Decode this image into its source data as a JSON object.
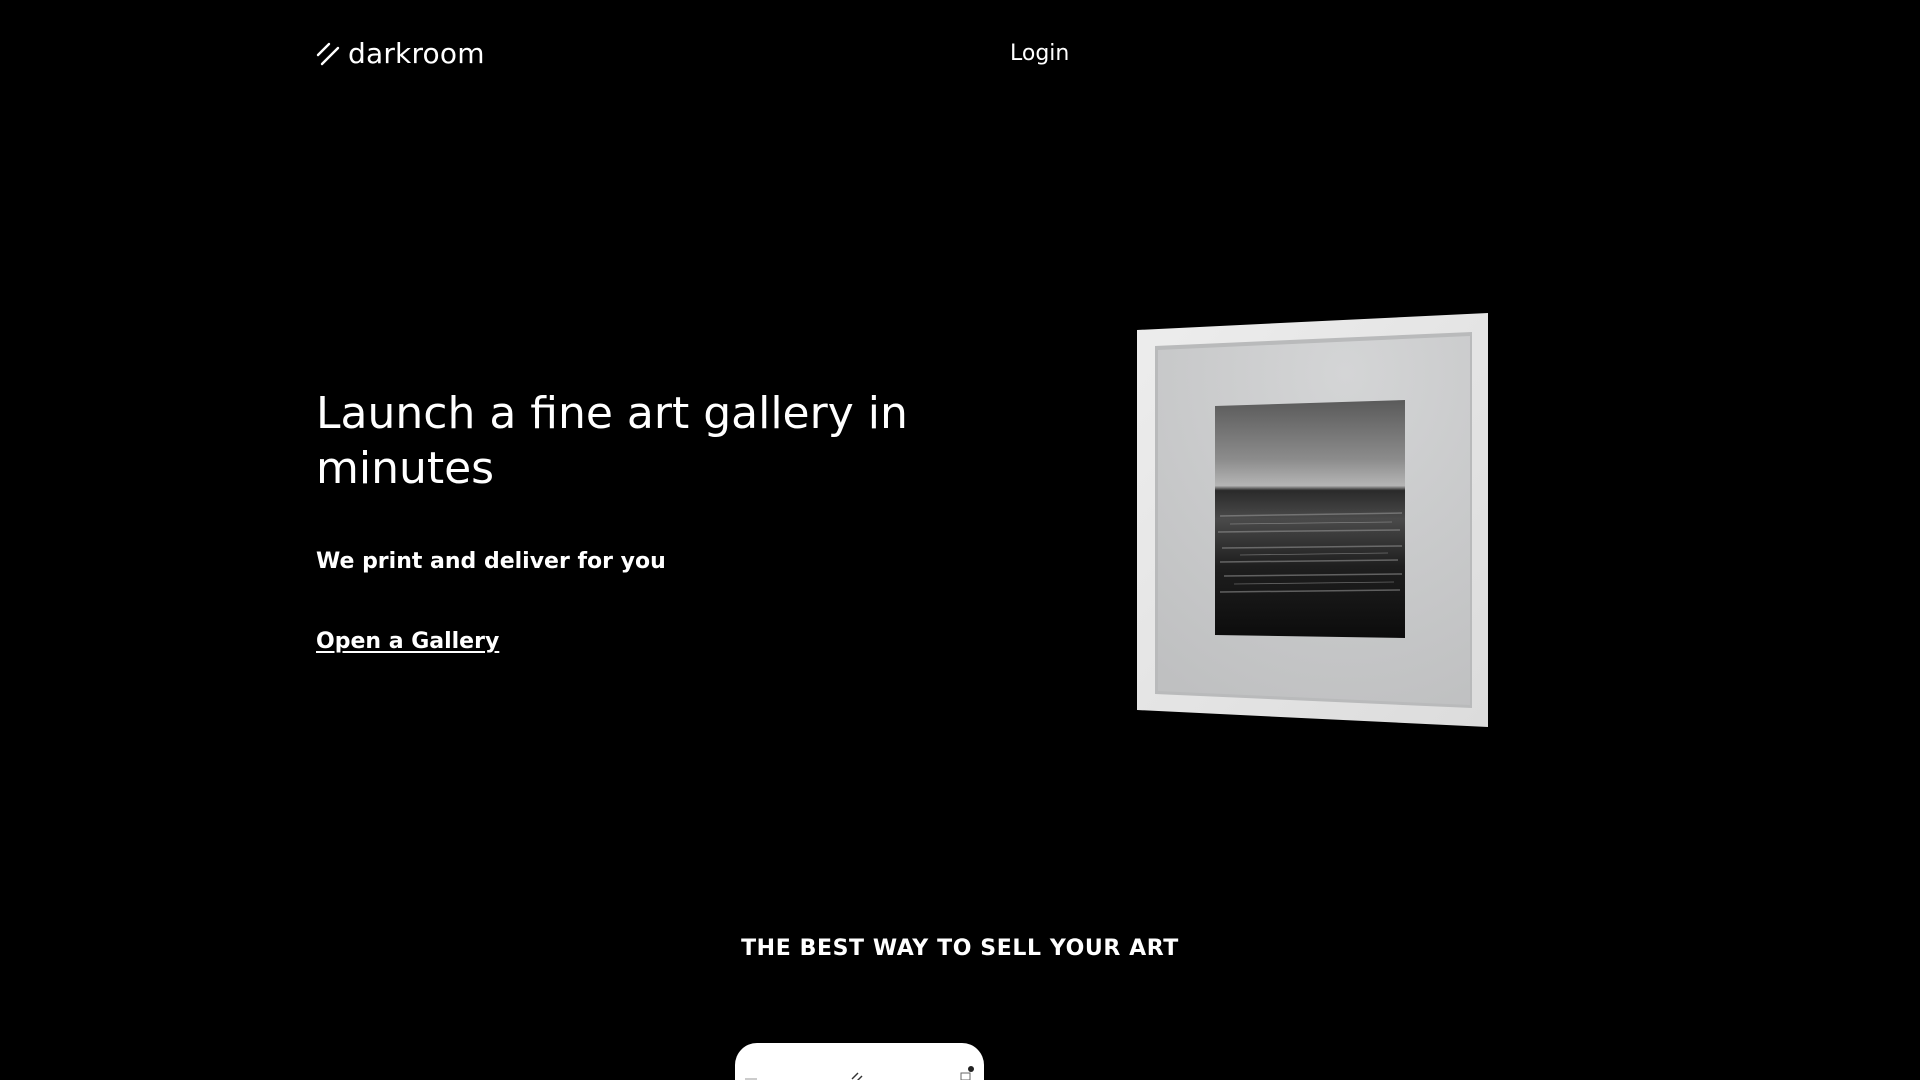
{
  "header": {
    "logo_text": "darkroom",
    "logo_icon": "double-slash-icon",
    "login_label": "Login"
  },
  "hero": {
    "title": "Launch a fine art gallery in minutes",
    "subtitle": "We print and deliver for you",
    "cta_label": "Open a Gallery"
  },
  "artwork": {
    "description_icon": "framed-photo-image",
    "frame_color": "#e6e6e6",
    "mat_color": "#c4c5c6"
  },
  "section": {
    "heading": "THE BEST WAY TO SELL YOUR ART"
  },
  "phone_preview": {
    "icons": [
      "menu-icon",
      "double-slash-icon",
      "cart-icon"
    ]
  },
  "colors": {
    "background": "#000000",
    "text": "#ffffff"
  }
}
